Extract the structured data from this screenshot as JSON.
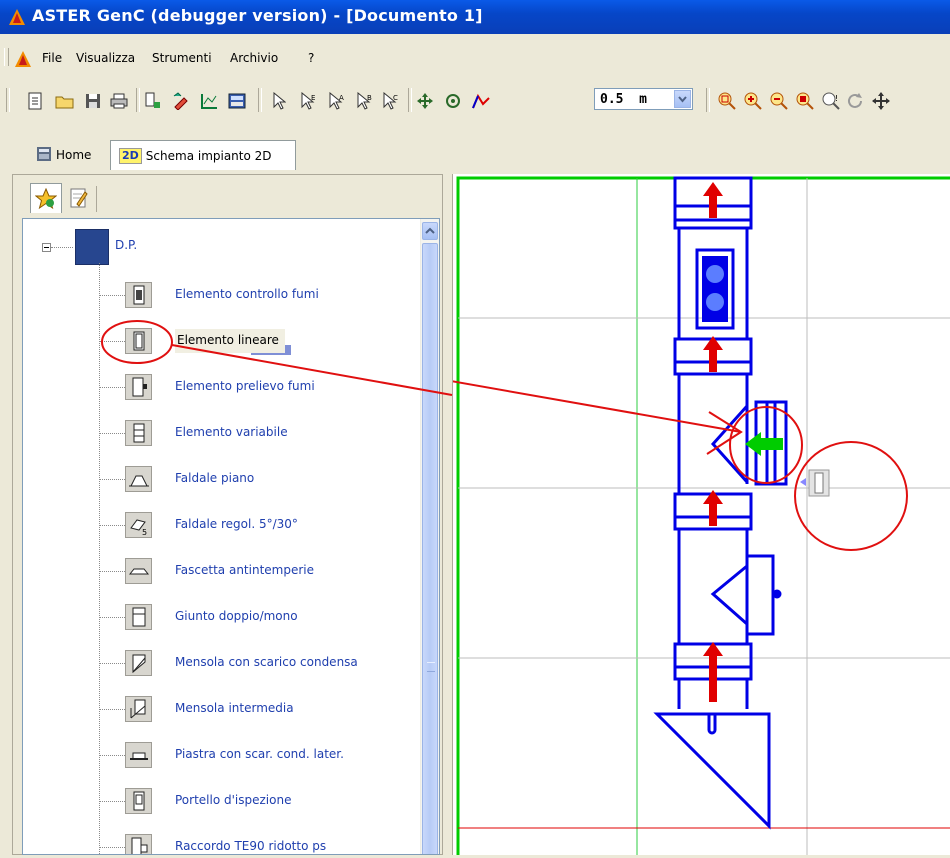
{
  "window": {
    "title": "ASTER GenC (debugger version) - [Documento 1]"
  },
  "menu": {
    "items": [
      "File",
      "Visualizza",
      "Strumenti",
      "Archivio",
      "?"
    ]
  },
  "toolbar": {
    "scale_value": "0.5  m",
    "icons": [
      "new-file-icon",
      "open-folder-icon",
      "save-icon",
      "print-icon",
      "add-element-icon",
      "edit-element-icon",
      "chart-icon",
      "calculator-icon",
      "pointer-icon",
      "select-icon",
      "select-a-icon",
      "select-b-icon",
      "select-c-icon",
      "move-icon",
      "rotate-icon",
      "polyline-icon",
      "zoom-window-icon",
      "zoom-in-icon",
      "zoom-out-icon",
      "zoom-extents-icon",
      "zoom-query-icon",
      "refresh-icon",
      "pan-icon"
    ]
  },
  "tabs": [
    {
      "label": "Home",
      "icon": "home-icon"
    },
    {
      "label": "Schema impianto 2D",
      "badge": "2D",
      "icon": "2d-icon"
    }
  ],
  "panel": {
    "tabs": [
      "favorites-star-icon",
      "notes-icon"
    ]
  },
  "tree": {
    "root": {
      "label": "D.P.",
      "expanded": true
    },
    "items": [
      {
        "label": "Elemento controllo fumi",
        "icon": "smoke-control-icon"
      },
      {
        "label": "Elemento lineare",
        "icon": "linear-element-icon",
        "selected": true
      },
      {
        "label": "Elemento prelievo fumi",
        "icon": "smoke-sampling-icon"
      },
      {
        "label": "Elemento variabile",
        "icon": "variable-element-icon"
      },
      {
        "label": "Faldale piano",
        "icon": "flat-flashing-icon"
      },
      {
        "label": "Faldale regol. 5°/30°",
        "icon": "adjustable-flashing-icon"
      },
      {
        "label": "Fascetta antintemperie",
        "icon": "storm-collar-icon"
      },
      {
        "label": "Giunto doppio/mono",
        "icon": "double-joint-icon"
      },
      {
        "label": "Mensola con scarico condensa",
        "icon": "bracket-drain-icon"
      },
      {
        "label": "Mensola intermedia",
        "icon": "intermediate-bracket-icon"
      },
      {
        "label": "Piastra con scar. cond. later.",
        "icon": "plate-drain-icon"
      },
      {
        "label": "Portello d'ispezione",
        "icon": "inspection-door-icon"
      },
      {
        "label": "Raccordo TE90 ridotto ps",
        "icon": "tee-fitting-icon"
      }
    ]
  },
  "colors": {
    "title_blue": "#0a4ed8",
    "pipe_blue": "#0000e6",
    "arrow_red": "#e00000",
    "annotation_red": "#e01010",
    "connector_green": "#00cc00",
    "grid_green": "#2ecc40",
    "grid_gray": "#b0b0b0"
  }
}
